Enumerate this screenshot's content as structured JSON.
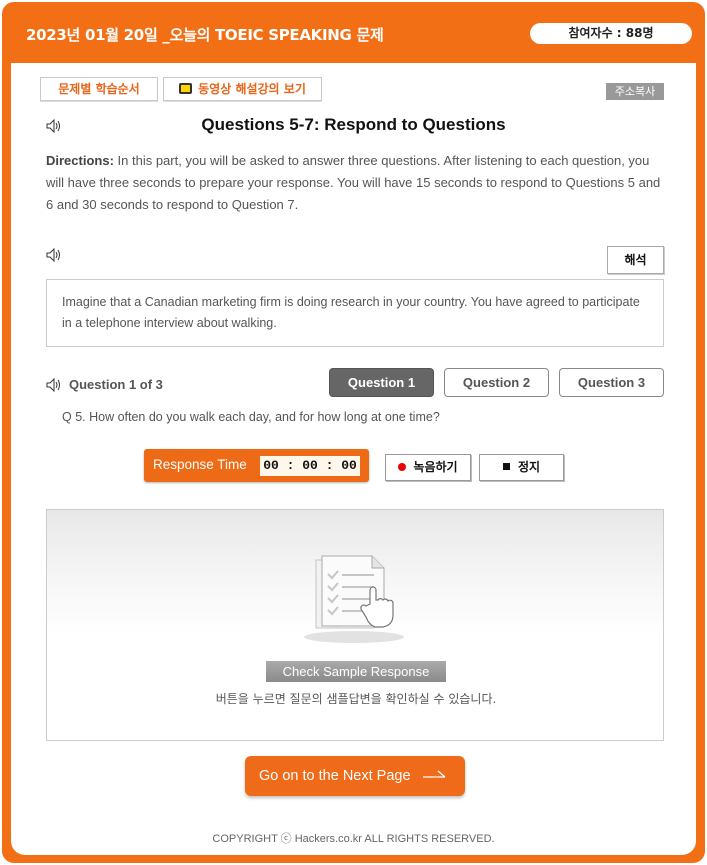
{
  "header": {
    "title": "2023년 01월 20일 _오늘의 TOEIC SPEAKING 문제",
    "participants": "참여자수 : 88명"
  },
  "tabs": {
    "study_order": "문제별 학습순서",
    "video_lecture": "동영상 해설강의 보기",
    "copy_address": "주소복사"
  },
  "section": {
    "title": "Questions 5-7: Respond to Questions",
    "directions_label": "Directions:",
    "directions_text": " In this part, you will be asked to answer three questions. After listening to each question, you will have three seconds to prepare your response. You will have 15 seconds to respond to Questions 5 and 6 and 30 seconds to respond to Question 7."
  },
  "translate_button": "해석",
  "scenario": "Imagine that a Canadian marketing firm is doing research in your country. You have agreed to participate in a telephone interview about walking.",
  "question": {
    "counter": "Question 1 of 3",
    "tabs": [
      "Question 1",
      "Question 2",
      "Question 3"
    ],
    "active_index": 0,
    "text": "Q 5. How often do you walk each day, and for how long at one time?"
  },
  "response": {
    "label": "Response Time",
    "timer": "00 : 00 : 00",
    "record_label": "녹음하기",
    "stop_label": "정지"
  },
  "sample": {
    "button": "Check Sample Response",
    "description": "버튼을 누르면 질문의 샘플답변을 확인하실 수 있습니다."
  },
  "next_button": "Go on to the Next Page",
  "footer": "COPYRIGHT ⓒ Hackers.co.kr ALL RIGHTS RESERVED.",
  "colors": {
    "accent": "#f26f16",
    "active_tab": "#666666"
  }
}
